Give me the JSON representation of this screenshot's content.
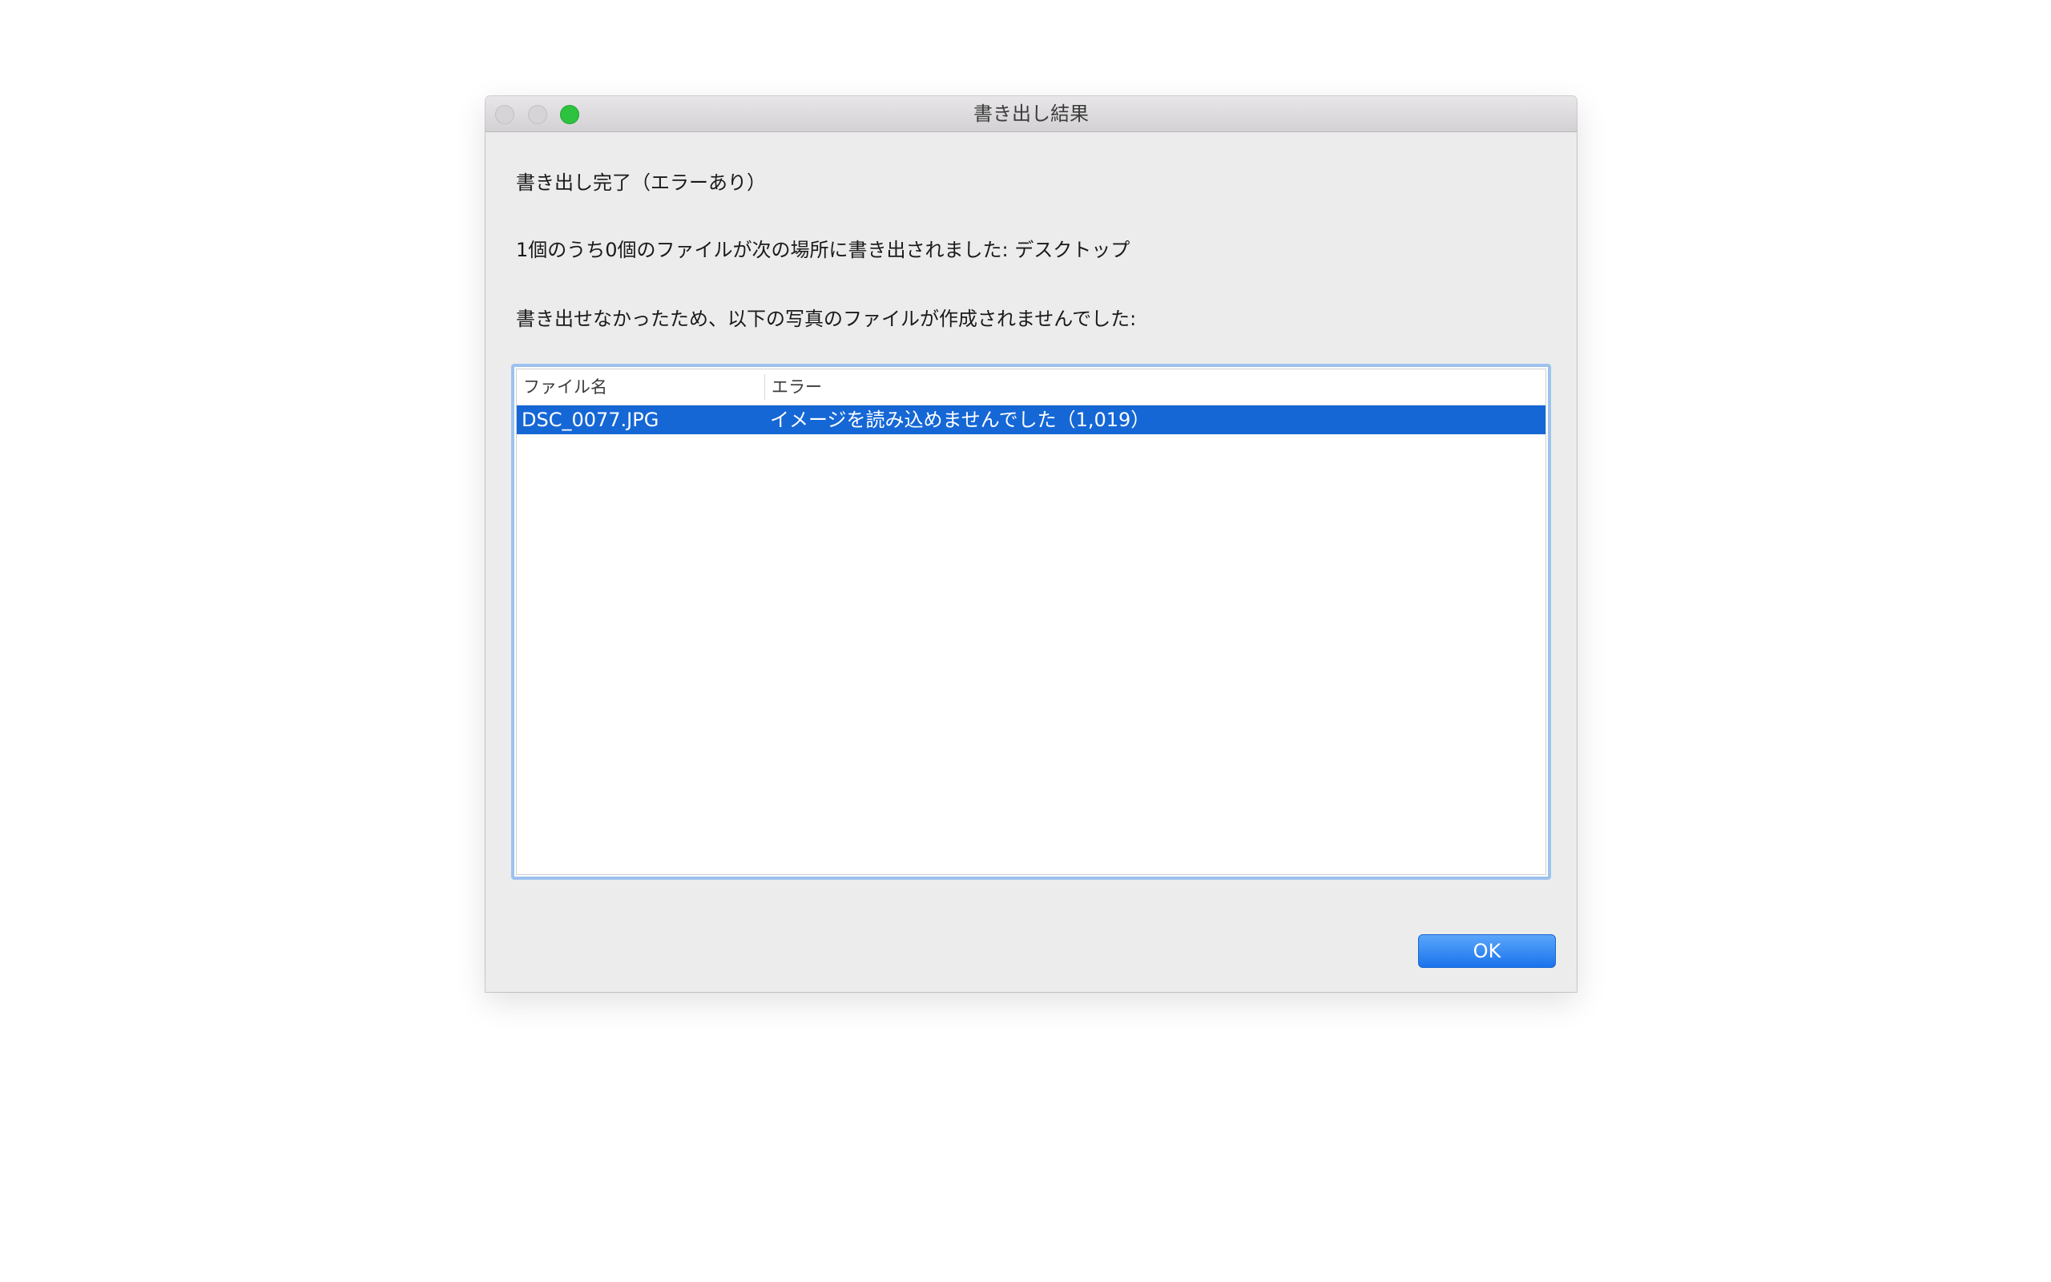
{
  "window": {
    "title": "書き出し結果"
  },
  "messages": {
    "status": "書き出し完了（エラーあり）",
    "summary": "1個のうち0個のファイルが次の場所に書き出されました: デスクトップ",
    "detail": "書き出せなかったため、以下の写真のファイルが作成されませんでした:"
  },
  "table": {
    "columns": [
      "ファイル名",
      "エラー"
    ],
    "rows": [
      {
        "filename": "DSC_0077.JPG",
        "error": "イメージを読み込めませんでした（1,019）",
        "selected": true
      }
    ]
  },
  "buttons": {
    "ok_label": "OK"
  },
  "colors": {
    "selection": "#1567d6",
    "focus_ring": "#9cc2ee",
    "zoom_button": "#2dc23f"
  },
  "icons": [
    "close-icon",
    "minimize-icon",
    "zoom-icon"
  ]
}
